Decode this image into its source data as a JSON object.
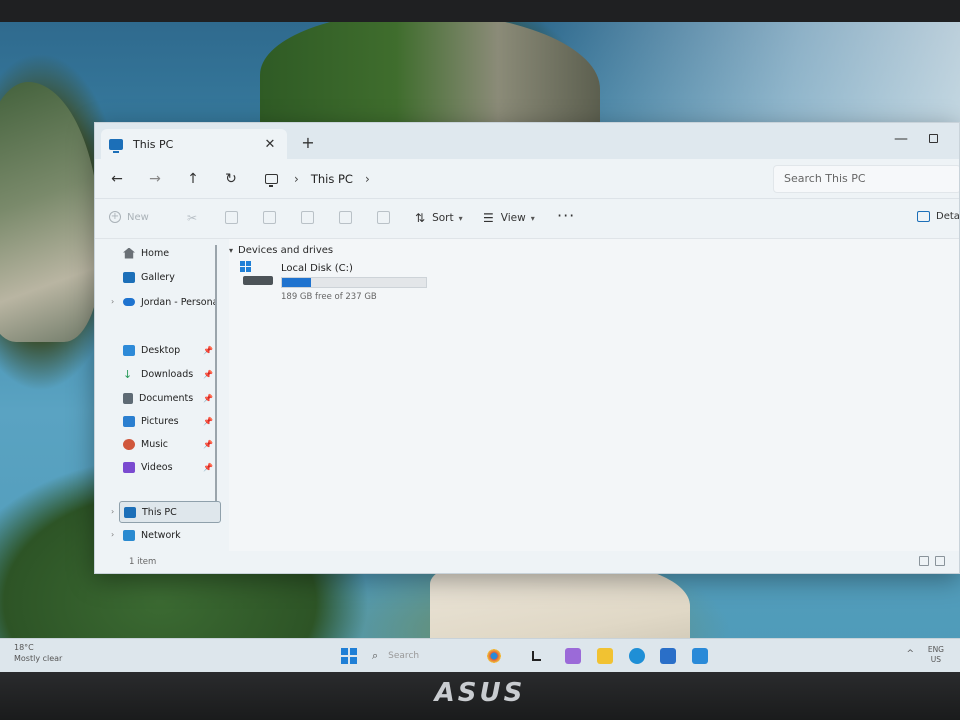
{
  "window": {
    "tab_title": "This PC",
    "tab_close": "✕",
    "new_tab": "+",
    "minimize": "—"
  },
  "nav": {
    "back": "←",
    "forward": "→",
    "up": "↑",
    "refresh": "↻",
    "breadcrumb": [
      "This PC"
    ],
    "search_placeholder": "Search This PC"
  },
  "commands": {
    "new_label": "New",
    "sort_label": "Sort",
    "view_label": "View",
    "more_label": "···",
    "details_label": "Detail"
  },
  "sidebar": {
    "top": [
      {
        "label": "Home",
        "color": "#6a7076"
      },
      {
        "label": "Gallery",
        "color": "#1c6fb8"
      },
      {
        "label": "Jordan - Persona",
        "color": "#1f73cf"
      }
    ],
    "pinned": [
      {
        "label": "Desktop",
        "color": "#2d8ad8"
      },
      {
        "label": "Downloads",
        "color": "#2a9a5a"
      },
      {
        "label": "Documents",
        "color": "#5e6a74"
      },
      {
        "label": "Pictures",
        "color": "#2b7fd0"
      },
      {
        "label": "Music",
        "color": "#d0573c"
      },
      {
        "label": "Videos",
        "color": "#7a4ad0"
      }
    ],
    "bottom": [
      {
        "label": "This PC",
        "color": "#1c6fb8",
        "selected": true
      },
      {
        "label": "Network",
        "color": "#2a8ad0"
      }
    ]
  },
  "content": {
    "group_header": "Devices and drives",
    "drive": {
      "name": "Local Disk (C:)",
      "free_text": "189 GB free of 237 GB",
      "used_fraction": 0.2
    }
  },
  "status": {
    "item_count": "1 item"
  },
  "taskbar": {
    "weather_temp": "18°C",
    "weather_desc": "Mostly clear",
    "search_placeholder": "Search",
    "lang_line1": "ENG",
    "lang_line2": "US",
    "overflow": "^",
    "apps": [
      {
        "name": "copilot",
        "color": "#9b6ad8"
      },
      {
        "name": "file-explorer",
        "color": "#f1c232"
      },
      {
        "name": "edge",
        "color": "#1f8fd6"
      },
      {
        "name": "store",
        "color": "#2a6fc8"
      },
      {
        "name": "mail",
        "color": "#2a8ad8"
      }
    ]
  },
  "brand": "ASUS"
}
